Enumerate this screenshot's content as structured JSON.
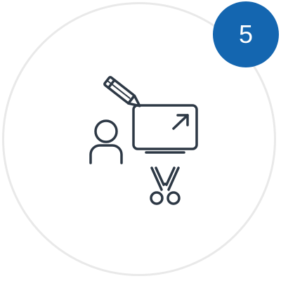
{
  "badge": {
    "step_number": "5",
    "color": "#1466b0"
  },
  "ring": {
    "color": "#e9e9e9"
  },
  "illustration": {
    "stroke_color": "#2d3845",
    "icons": [
      "person-icon",
      "monitor-icon",
      "arrow-up-right-icon",
      "pencil-icon",
      "scissors-icon"
    ]
  }
}
